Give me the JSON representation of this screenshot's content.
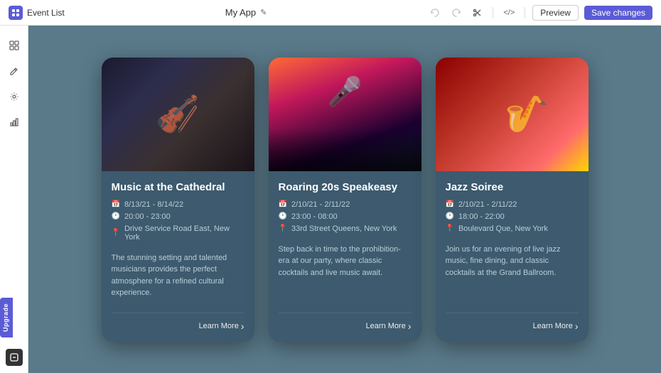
{
  "topbar": {
    "app_title": "Event List",
    "center_title": "My App",
    "edit_icon": "✎",
    "preview_label": "Preview",
    "save_label": "Save changes",
    "undo_icon": "↺",
    "redo_icon": "↻",
    "scissors_icon": "✂",
    "code_icon": "</>",
    "app_icon_color": "#5b5bd6"
  },
  "sidebar": {
    "icons": [
      "⊞",
      "✎",
      "⚙",
      "📊"
    ]
  },
  "upgrade": {
    "label": "Upgrade"
  },
  "cards": [
    {
      "id": "card-1",
      "image_type": "orchestra",
      "title": "Music at the Cathedral",
      "date": "8/13/21 - 8/14/22",
      "time": "20:00 - 23:00",
      "location": "Drive Service Road East, New York",
      "description": "The stunning setting and talented musicians provides the perfect atmosphere for a refined cultural experience.",
      "learn_more": "Learn More"
    },
    {
      "id": "card-2",
      "image_type": "concert",
      "title": "Roaring 20s Speakeasy",
      "date": "2/10/21 - 2/11/22",
      "time": "23:00 - 08:00",
      "location": "33rd Street Queens, New York",
      "description": "Step back in time to the prohibition-era at our party, where classic cocktails and live music await.",
      "learn_more": "Learn More"
    },
    {
      "id": "card-3",
      "image_type": "jazz",
      "title": "Jazz Soiree",
      "date": "2/10/21 - 2/11/22",
      "time": "18:00 - 22:00",
      "location": "Boulevard Que, New York",
      "description": "Join us for an evening of live jazz music, fine dining, and classic cocktails at the Grand Ballroom.",
      "learn_more": "Learn More"
    }
  ]
}
